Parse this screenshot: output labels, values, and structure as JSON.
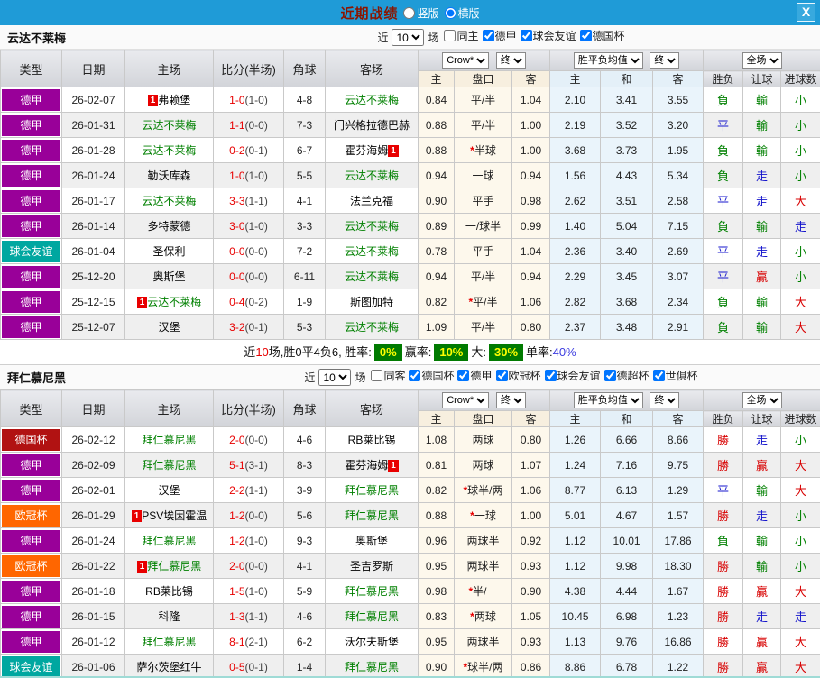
{
  "titlebar": {
    "title": "近期战绩",
    "radios": [
      {
        "label": "竖版",
        "checked": false
      },
      {
        "label": "横版",
        "checked": true
      }
    ],
    "close": "X"
  },
  "table_header": {
    "type": "类型",
    "date": "日期",
    "home": "主场",
    "score": "比分(半场)",
    "corner": "角球",
    "away": "客场",
    "odds_select": "Crow*",
    "odds_final": "终",
    "avg_select": "胜平负均值",
    "avg_final": "终",
    "scope_select": "全场",
    "h2": {
      "home": "主",
      "handicap": "盘口",
      "away": "客",
      "avg_home": "主",
      "avg_draw": "和",
      "avg_away": "客",
      "wdl": "胜负",
      "let": "让球",
      "goals": "进球数"
    }
  },
  "colors": {
    "accent_blue": "#1f9bd7",
    "team_green": "#008000",
    "score_red": "#e80000",
    "badge_bg": "#007a00",
    "badge_text": "#ffff00",
    "league": {
      "德甲": "#990099",
      "德国杯": "#b11212",
      "欧冠杯": "#ff6600",
      "球会友谊": "#00a7a0"
    },
    "result": {
      "勝": "#d80000",
      "贏": "#d80000",
      "大": "#d80000",
      "平": "#1515cc",
      "走": "#1515cc",
      "負": "#008000",
      "輸": "#008000",
      "小": "#008000"
    }
  },
  "sections": [
    {
      "team": "云达不莱梅",
      "filters": {
        "near_label": "近",
        "count": "10",
        "games_label": "场",
        "same_label": "同主",
        "same_checked": false,
        "leagues": [
          {
            "label": "德甲",
            "checked": true
          },
          {
            "label": "球会友谊",
            "checked": true
          },
          {
            "label": "德国杯",
            "checked": true
          }
        ]
      },
      "rows": [
        {
          "league": "德甲",
          "date": "26-02-07",
          "home": "弗赖堡",
          "home_green": false,
          "home_card": true,
          "ft": "1-0",
          "ht": "(1-0)",
          "corner": "4-8",
          "away": "云达不莱梅",
          "away_green": true,
          "away_card": false,
          "o1": "0.84",
          "pk": "平/半",
          "pk_star": false,
          "o2": "1.04",
          "a1": "2.10",
          "a2": "3.41",
          "a3": "3.55",
          "r1": "負",
          "r2": "輸",
          "r3": "小"
        },
        {
          "league": "德甲",
          "date": "26-01-31",
          "home": "云达不莱梅",
          "home_green": true,
          "home_card": false,
          "ft": "1-1",
          "ht": "(0-0)",
          "corner": "7-3",
          "away": "门兴格拉德巴赫",
          "away_green": false,
          "away_card": false,
          "o1": "0.88",
          "pk": "平/半",
          "pk_star": false,
          "o2": "1.00",
          "a1": "2.19",
          "a2": "3.52",
          "a3": "3.20",
          "r1": "平",
          "r2": "輸",
          "r3": "小"
        },
        {
          "league": "德甲",
          "date": "26-01-28",
          "home": "云达不莱梅",
          "home_green": true,
          "home_card": false,
          "ft": "0-2",
          "ht": "(0-1)",
          "corner": "6-7",
          "away": "霍芬海姆",
          "away_green": false,
          "away_card": true,
          "o1": "0.88",
          "pk": "半球",
          "pk_star": true,
          "o2": "1.00",
          "a1": "3.68",
          "a2": "3.73",
          "a3": "1.95",
          "r1": "負",
          "r2": "輸",
          "r3": "小"
        },
        {
          "league": "德甲",
          "date": "26-01-24",
          "home": "勒沃库森",
          "home_green": false,
          "home_card": false,
          "ft": "1-0",
          "ht": "(1-0)",
          "corner": "5-5",
          "away": "云达不莱梅",
          "away_green": true,
          "away_card": false,
          "o1": "0.94",
          "pk": "一球",
          "pk_star": false,
          "o2": "0.94",
          "a1": "1.56",
          "a2": "4.43",
          "a3": "5.34",
          "r1": "負",
          "r2": "走",
          "r3": "小"
        },
        {
          "league": "德甲",
          "date": "26-01-17",
          "home": "云达不莱梅",
          "home_green": true,
          "home_card": false,
          "ft": "3-3",
          "ht": "(1-1)",
          "corner": "4-1",
          "away": "法兰克福",
          "away_green": false,
          "away_card": false,
          "o1": "0.90",
          "pk": "平手",
          "pk_star": false,
          "o2": "0.98",
          "a1": "2.62",
          "a2": "3.51",
          "a3": "2.58",
          "r1": "平",
          "r2": "走",
          "r3": "大"
        },
        {
          "league": "德甲",
          "date": "26-01-14",
          "home": "多特蒙德",
          "home_green": false,
          "home_card": false,
          "ft": "3-0",
          "ht": "(1-0)",
          "corner": "3-3",
          "away": "云达不莱梅",
          "away_green": true,
          "away_card": false,
          "o1": "0.89",
          "pk": "一/球半",
          "pk_star": false,
          "o2": "0.99",
          "a1": "1.40",
          "a2": "5.04",
          "a3": "7.15",
          "r1": "負",
          "r2": "輸",
          "r3": "走"
        },
        {
          "league": "球会友谊",
          "date": "26-01-04",
          "home": "圣保利",
          "home_green": false,
          "home_card": false,
          "ft": "0-0",
          "ht": "(0-0)",
          "corner": "7-2",
          "away": "云达不莱梅",
          "away_green": true,
          "away_card": false,
          "o1": "0.78",
          "pk": "平手",
          "pk_star": false,
          "o2": "1.04",
          "a1": "2.36",
          "a2": "3.40",
          "a3": "2.69",
          "r1": "平",
          "r2": "走",
          "r3": "小"
        },
        {
          "league": "德甲",
          "date": "25-12-20",
          "home": "奥斯堡",
          "home_green": false,
          "home_card": false,
          "ft": "0-0",
          "ht": "(0-0)",
          "corner": "6-11",
          "away": "云达不莱梅",
          "away_green": true,
          "away_card": false,
          "o1": "0.94",
          "pk": "平/半",
          "pk_star": false,
          "o2": "0.94",
          "a1": "2.29",
          "a2": "3.45",
          "a3": "3.07",
          "r1": "平",
          "r2": "贏",
          "r3": "小"
        },
        {
          "league": "德甲",
          "date": "25-12-15",
          "home": "云达不莱梅",
          "home_green": true,
          "home_card": true,
          "ft": "0-4",
          "ht": "(0-2)",
          "corner": "1-9",
          "away": "斯图加特",
          "away_green": false,
          "away_card": false,
          "o1": "0.82",
          "pk": "平/半",
          "pk_star": true,
          "o2": "1.06",
          "a1": "2.82",
          "a2": "3.68",
          "a3": "2.34",
          "r1": "負",
          "r2": "輸",
          "r3": "大"
        },
        {
          "league": "德甲",
          "date": "25-12-07",
          "home": "汉堡",
          "home_green": false,
          "home_card": false,
          "ft": "3-2",
          "ht": "(0-1)",
          "corner": "5-3",
          "away": "云达不莱梅",
          "away_green": true,
          "away_card": false,
          "o1": "1.09",
          "pk": "平/半",
          "pk_star": false,
          "o2": "0.80",
          "a1": "2.37",
          "a2": "3.48",
          "a3": "2.91",
          "r1": "負",
          "r2": "輸",
          "r3": "大"
        }
      ],
      "summary": [
        {
          "t": "近"
        },
        {
          "t": "10",
          "c": "red"
        },
        {
          "t": "场,胜0平4负6, 胜率:"
        },
        {
          "t": "0%",
          "badge": true
        },
        {
          "t": "赢率:"
        },
        {
          "t": "10%",
          "badge": true
        },
        {
          "t": "大:"
        },
        {
          "t": "30%",
          "badge": true
        },
        {
          "t": "单率:"
        },
        {
          "t": "40%",
          "c": "blue"
        }
      ]
    },
    {
      "team": "拜仁慕尼黑",
      "filters": {
        "near_label": "近",
        "count": "10",
        "games_label": "场",
        "same_label": "同客",
        "same_checked": false,
        "leagues": [
          {
            "label": "德国杯",
            "checked": true
          },
          {
            "label": "德甲",
            "checked": true
          },
          {
            "label": "欧冠杯",
            "checked": true
          },
          {
            "label": "球会友谊",
            "checked": true
          },
          {
            "label": "德超杯",
            "checked": true
          },
          {
            "label": "世俱杯",
            "checked": true
          }
        ]
      },
      "rows": [
        {
          "league": "德国杯",
          "date": "26-02-12",
          "home": "拜仁慕尼黑",
          "home_green": true,
          "home_card": false,
          "ft": "2-0",
          "ht": "(0-0)",
          "corner": "4-6",
          "away": "RB莱比锡",
          "away_green": false,
          "away_card": false,
          "o1": "1.08",
          "pk": "两球",
          "pk_star": false,
          "o2": "0.80",
          "a1": "1.26",
          "a2": "6.66",
          "a3": "8.66",
          "r1": "勝",
          "r2": "走",
          "r3": "小"
        },
        {
          "league": "德甲",
          "date": "26-02-09",
          "home": "拜仁慕尼黑",
          "home_green": true,
          "home_card": false,
          "ft": "5-1",
          "ht": "(3-1)",
          "corner": "8-3",
          "away": "霍芬海姆",
          "away_green": false,
          "away_card": true,
          "o1": "0.81",
          "pk": "两球",
          "pk_star": false,
          "o2": "1.07",
          "a1": "1.24",
          "a2": "7.16",
          "a3": "9.75",
          "r1": "勝",
          "r2": "贏",
          "r3": "大"
        },
        {
          "league": "德甲",
          "date": "26-02-01",
          "home": "汉堡",
          "home_green": false,
          "home_card": false,
          "ft": "2-2",
          "ht": "(1-1)",
          "corner": "3-9",
          "away": "拜仁慕尼黑",
          "away_green": true,
          "away_card": false,
          "o1": "0.82",
          "pk": "球半/两",
          "pk_star": true,
          "o2": "1.06",
          "a1": "8.77",
          "a2": "6.13",
          "a3": "1.29",
          "r1": "平",
          "r2": "輸",
          "r3": "大"
        },
        {
          "league": "欧冠杯",
          "date": "26-01-29",
          "home": "PSV埃因霍温",
          "home_green": false,
          "home_card": true,
          "ft": "1-2",
          "ht": "(0-0)",
          "corner": "5-6",
          "away": "拜仁慕尼黑",
          "away_green": true,
          "away_card": false,
          "o1": "0.88",
          "pk": "一球",
          "pk_star": true,
          "o2": "1.00",
          "a1": "5.01",
          "a2": "4.67",
          "a3": "1.57",
          "r1": "勝",
          "r2": "走",
          "r3": "小"
        },
        {
          "league": "德甲",
          "date": "26-01-24",
          "home": "拜仁慕尼黑",
          "home_green": true,
          "home_card": false,
          "ft": "1-2",
          "ht": "(1-0)",
          "corner": "9-3",
          "away": "奥斯堡",
          "away_green": false,
          "away_card": false,
          "o1": "0.96",
          "pk": "两球半",
          "pk_star": false,
          "o2": "0.92",
          "a1": "1.12",
          "a2": "10.01",
          "a3": "17.86",
          "r1": "負",
          "r2": "輸",
          "r3": "小"
        },
        {
          "league": "欧冠杯",
          "date": "26-01-22",
          "home": "拜仁慕尼黑",
          "home_green": true,
          "home_card": true,
          "ft": "2-0",
          "ht": "(0-0)",
          "corner": "4-1",
          "away": "圣吉罗斯",
          "away_green": false,
          "away_card": false,
          "o1": "0.95",
          "pk": "两球半",
          "pk_star": false,
          "o2": "0.93",
          "a1": "1.12",
          "a2": "9.98",
          "a3": "18.30",
          "r1": "勝",
          "r2": "輸",
          "r3": "小"
        },
        {
          "league": "德甲",
          "date": "26-01-18",
          "home": "RB莱比锡",
          "home_green": false,
          "home_card": false,
          "ft": "1-5",
          "ht": "(1-0)",
          "corner": "5-9",
          "away": "拜仁慕尼黑",
          "away_green": true,
          "away_card": false,
          "o1": "0.98",
          "pk": "半/一",
          "pk_star": true,
          "o2": "0.90",
          "a1": "4.38",
          "a2": "4.44",
          "a3": "1.67",
          "r1": "勝",
          "r2": "贏",
          "r3": "大"
        },
        {
          "league": "德甲",
          "date": "26-01-15",
          "home": "科隆",
          "home_green": false,
          "home_card": false,
          "ft": "1-3",
          "ht": "(1-1)",
          "corner": "4-6",
          "away": "拜仁慕尼黑",
          "away_green": true,
          "away_card": false,
          "o1": "0.83",
          "pk": "两球",
          "pk_star": true,
          "o2": "1.05",
          "a1": "10.45",
          "a2": "6.98",
          "a3": "1.23",
          "r1": "勝",
          "r2": "走",
          "r3": "走"
        },
        {
          "league": "德甲",
          "date": "26-01-12",
          "home": "拜仁慕尼黑",
          "home_green": true,
          "home_card": false,
          "ft": "8-1",
          "ht": "(2-1)",
          "corner": "6-2",
          "away": "沃尔夫斯堡",
          "away_green": false,
          "away_card": false,
          "o1": "0.95",
          "pk": "两球半",
          "pk_star": false,
          "o2": "0.93",
          "a1": "1.13",
          "a2": "9.76",
          "a3": "16.86",
          "r1": "勝",
          "r2": "贏",
          "r3": "大"
        },
        {
          "league": "球会友谊",
          "date": "26-01-06",
          "home": "萨尔茨堡红牛",
          "home_green": false,
          "home_card": false,
          "ft": "0-5",
          "ht": "(0-1)",
          "corner": "1-4",
          "away": "拜仁慕尼黑",
          "away_green": true,
          "away_card": false,
          "o1": "0.90",
          "pk": "球半/两",
          "pk_star": true,
          "o2": "0.86",
          "a1": "8.86",
          "a2": "6.78",
          "a3": "1.22",
          "r1": "勝",
          "r2": "贏",
          "r3": "大"
        }
      ]
    }
  ]
}
